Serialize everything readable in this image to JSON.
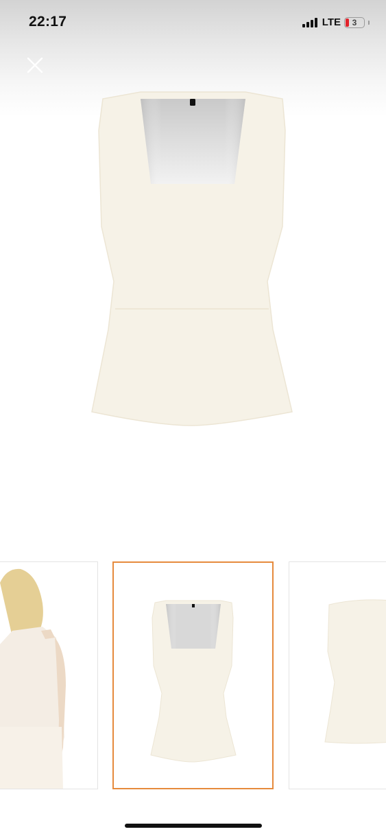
{
  "status_bar": {
    "time": "22:17",
    "network": "LTE",
    "battery_level": "3",
    "battery_color": "#e2242c",
    "signal_icon": "cellular-signal-icon",
    "battery_icon": "battery-icon"
  },
  "viewer": {
    "close_icon": "close-icon",
    "main_image": "white-square-neck-tank-top-front-image",
    "selected_thumbnail": 2
  },
  "thumbnails": [
    {
      "name": "model-back-view-thumbnail",
      "selected": false
    },
    {
      "name": "tank-top-front-thumbnail",
      "selected": true
    },
    {
      "name": "tank-top-back-thumbnail",
      "selected": false
    }
  ],
  "colors": {
    "selected_border": "#e68a3c",
    "garment": "#f6f2e7",
    "background": "#ffffff"
  }
}
